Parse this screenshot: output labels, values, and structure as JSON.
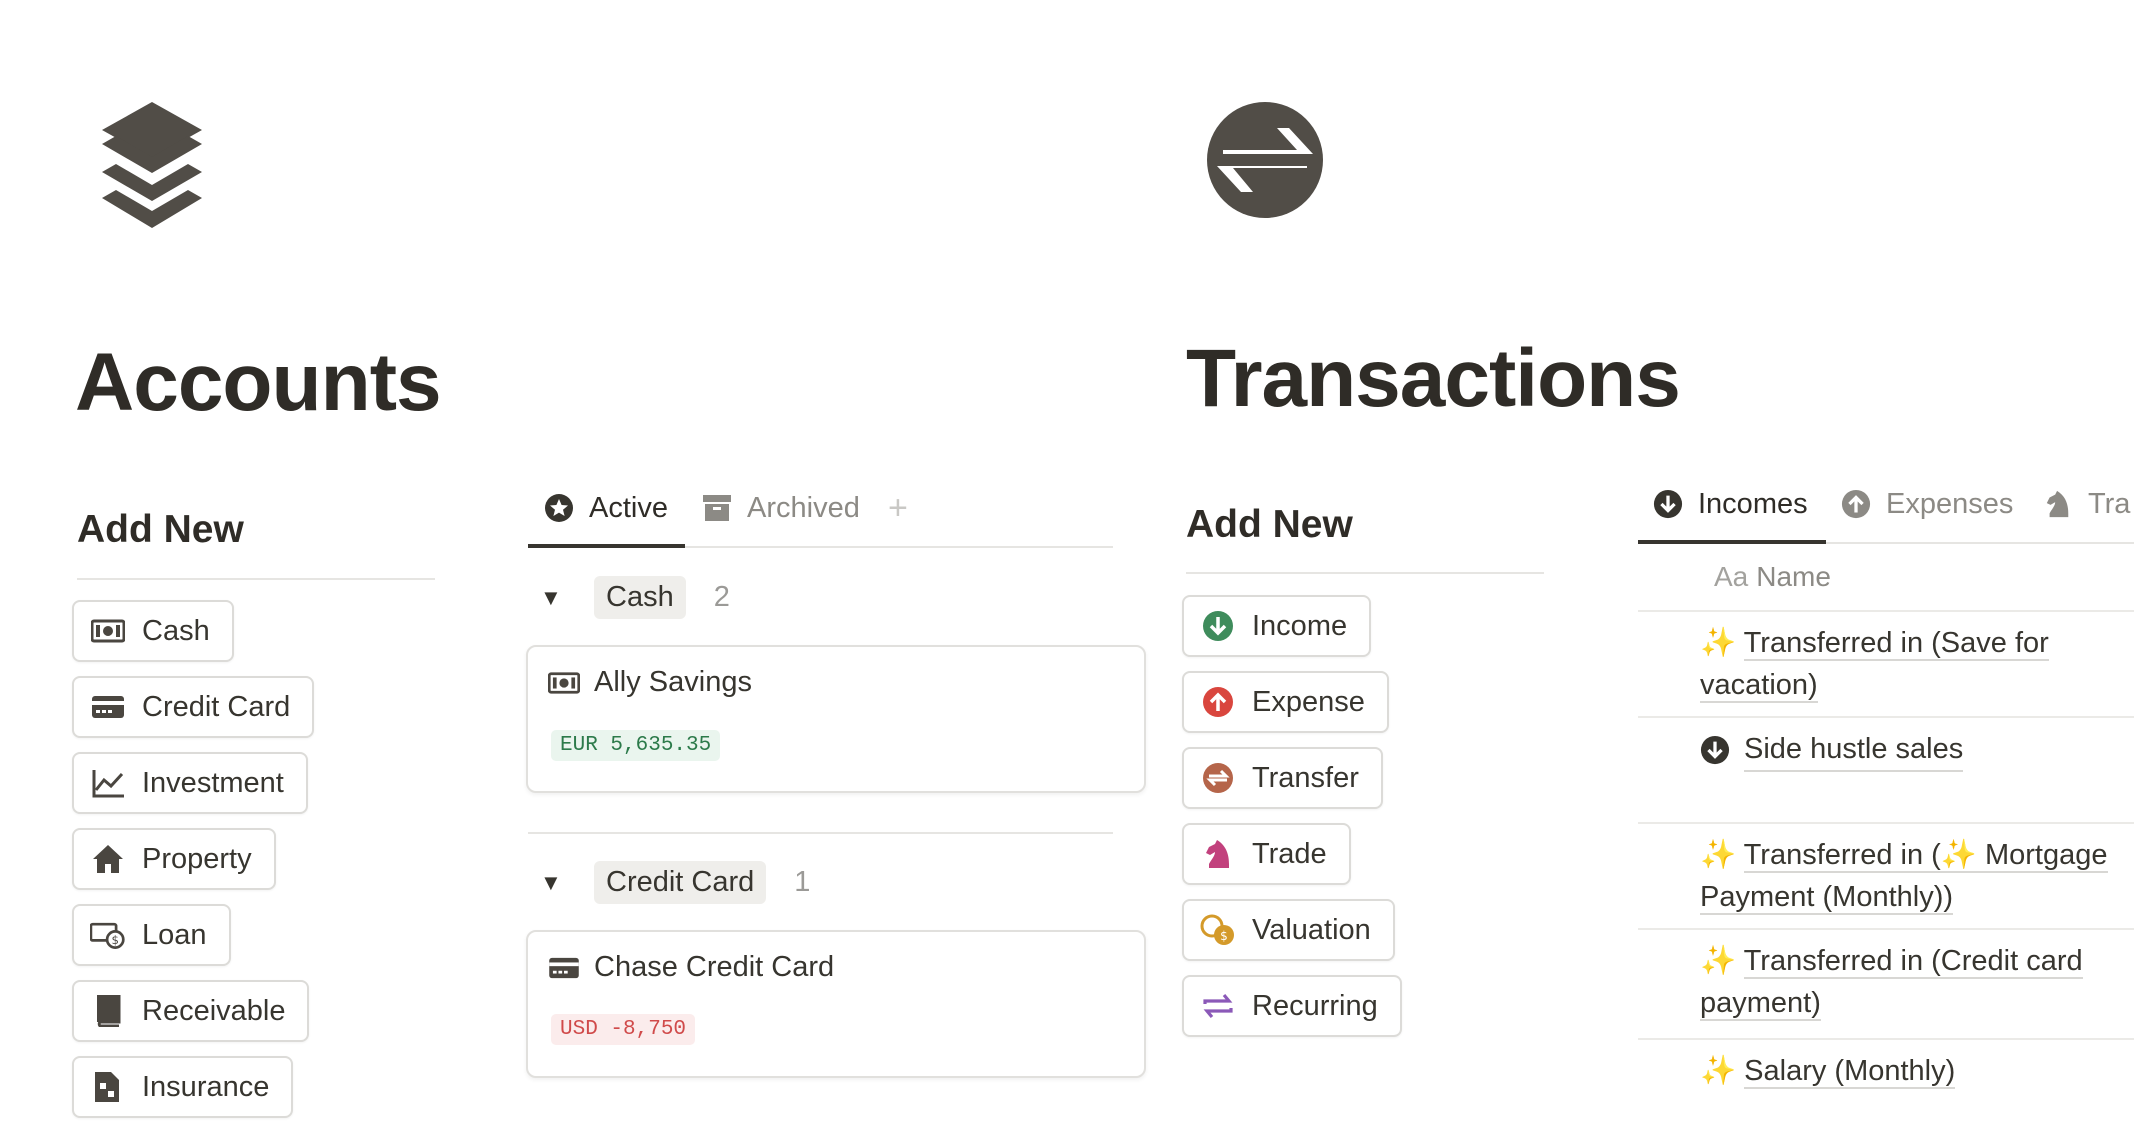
{
  "accounts": {
    "title": "Accounts",
    "add_new": "Add New",
    "buttons": [
      {
        "label": "Cash",
        "icon": "cash-icon"
      },
      {
        "label": "Credit Card",
        "icon": "credit-card-icon"
      },
      {
        "label": "Investment",
        "icon": "chart-line-icon"
      },
      {
        "label": "Property",
        "icon": "home-icon"
      },
      {
        "label": "Loan",
        "icon": "loan-icon"
      },
      {
        "label": "Receivable",
        "icon": "book-icon"
      },
      {
        "label": "Insurance",
        "icon": "insurance-icon"
      }
    ],
    "tabs": {
      "active": "Active",
      "archived": "Archived",
      "add": "+"
    },
    "groups": [
      {
        "name": "Cash",
        "count": "2",
        "card": {
          "title": "Ally Savings",
          "amount": "EUR 5,635.35"
        }
      },
      {
        "name": "Credit Card",
        "count": "1",
        "card": {
          "title": "Chase Credit Card",
          "amount": "USD -8,750"
        }
      }
    ]
  },
  "transactions": {
    "title": "Transactions",
    "add_new": "Add New",
    "buttons": [
      {
        "label": "Income",
        "icon": "income-arrow-down-icon"
      },
      {
        "label": "Expense",
        "icon": "expense-arrow-up-icon"
      },
      {
        "label": "Transfer",
        "icon": "transfer-icon"
      },
      {
        "label": "Trade",
        "icon": "chess-knight-icon"
      },
      {
        "label": "Valuation",
        "icon": "coins-icon"
      },
      {
        "label": "Recurring",
        "icon": "repeat-icon"
      }
    ],
    "tabs": {
      "incomes": "Incomes",
      "expenses": "Expenses",
      "trades": "Tra"
    },
    "column": {
      "prefix": "Aa",
      "name": "Name"
    },
    "rows": [
      {
        "spark": "✨",
        "line1": "Transferred in (Save for",
        "line2": "vacation)"
      },
      {
        "line1": "Side hustle sales"
      },
      {
        "spark": "✨",
        "line1a": "Transferred in (",
        "spark2": "✨",
        "line1b": " Mortgage",
        "line2": "Payment (Monthly))"
      },
      {
        "spark": "✨",
        "line1": "Transferred in (Credit card",
        "line2": "payment)"
      },
      {
        "spark": "✨",
        "line1": "Salary (Monthly)"
      }
    ]
  },
  "colors": {
    "text": "#37352f",
    "income": "#3f8c5c",
    "expense": "#d9463e",
    "transfer": "#b5654a",
    "trade": "#c2417d",
    "valuation": "#d49a2a",
    "recurring": "#8b59b8"
  }
}
